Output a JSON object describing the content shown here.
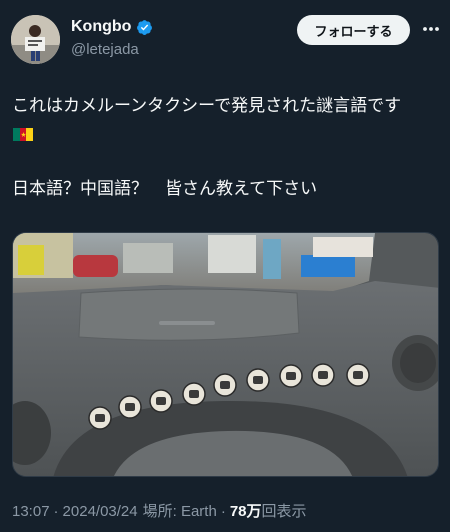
{
  "author": {
    "display_name": "Kongbo",
    "handle": "@letejada",
    "verified": true
  },
  "follow_label": "フォローする",
  "tweet": {
    "line1": "これはカメルーンタクシーで発見された謎言語です",
    "flag": "Cameroon flag",
    "line2": "日本語？中国語？　皆さん教えて下さい"
  },
  "meta": {
    "time": "13:07",
    "sep1": "·",
    "date": "2024/03/24",
    "location": "場所: Earth",
    "sep2": "·",
    "views_count": "78万",
    "views_label": "回表示"
  },
  "colors": {
    "background": "#15202b",
    "verified_blue": "#1d9bf0",
    "secondary_text": "#8b98a5"
  }
}
